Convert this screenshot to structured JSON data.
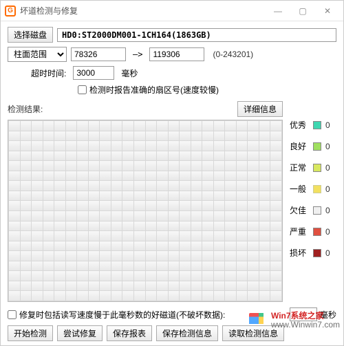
{
  "window": {
    "title": "坏道检测与修复"
  },
  "disk": {
    "select_button": "选择磁盘",
    "label": "HD0:ST2000DM001-1CH164(1863GB)"
  },
  "range": {
    "mode_label": "柱面范围",
    "from": "78326",
    "to": "119306",
    "max": "(0-243201)"
  },
  "timeout": {
    "label": "超时时间:",
    "value": "3000",
    "unit": "毫秒"
  },
  "accurate_checkbox": "检测时报告准确的扇区号(速度较慢)",
  "result": {
    "label": "检测结果:",
    "detail_button": "详细信息"
  },
  "legend": {
    "excellent": {
      "label": "优秀",
      "count": 0
    },
    "good": {
      "label": "良好",
      "count": 0
    },
    "normal": {
      "label": "正常",
      "count": 0
    },
    "general": {
      "label": "一般",
      "count": 0
    },
    "poor": {
      "label": "欠佳",
      "count": 0
    },
    "severe": {
      "label": "严重",
      "count": 0
    },
    "bad": {
      "label": "损坏",
      "count": 0
    }
  },
  "footer": {
    "repair_note_prefix": "修复时包括读写速度慢于此毫秒数的好磁道(不破坏数据):",
    "repair_threshold": "",
    "repair_unit": "毫秒",
    "buttons": {
      "start": "开始检测",
      "try_repair": "尝试修复",
      "save_report": "保存报表",
      "save_info": "保存检测信息",
      "read_info": "读取检测信息"
    }
  },
  "watermark": {
    "line1": "Win7系统之家",
    "line2": "www.Winwin7.com"
  }
}
